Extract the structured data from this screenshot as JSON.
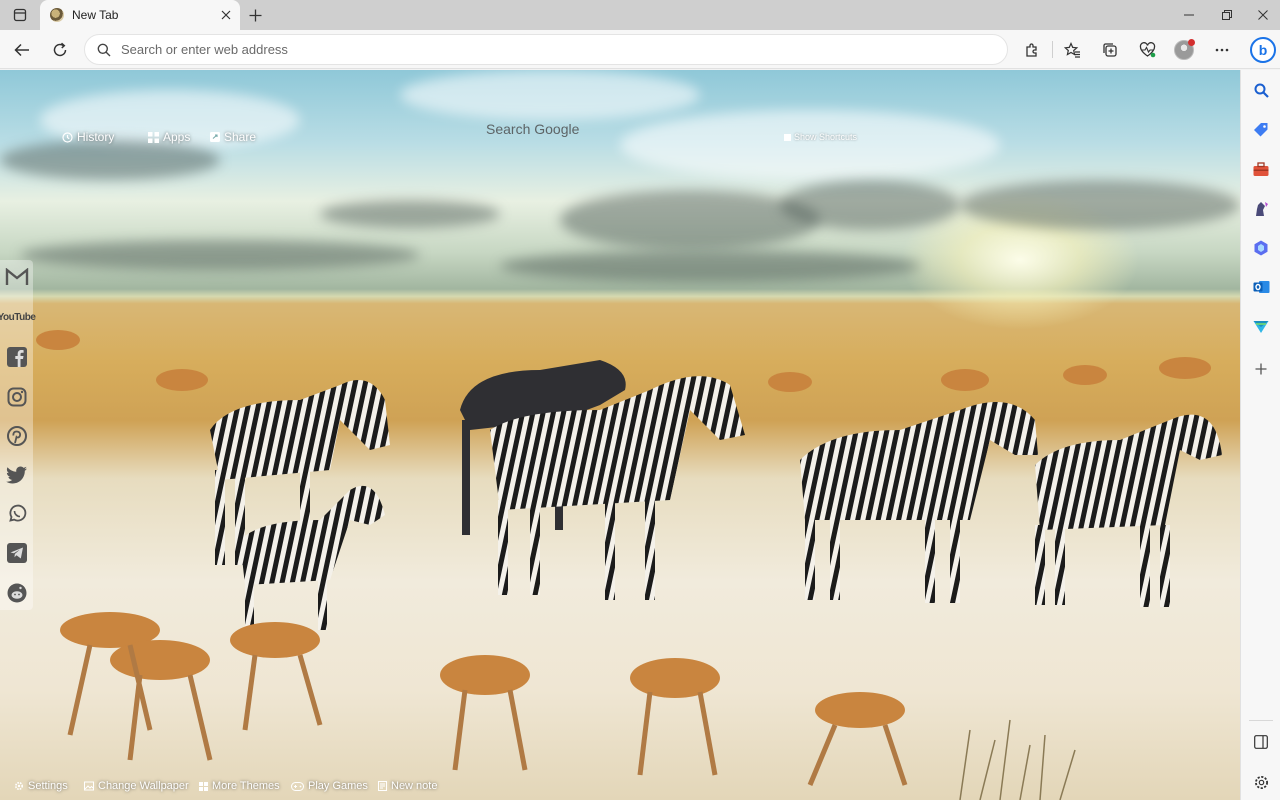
{
  "browser": {
    "tab": {
      "title": "New Tab"
    },
    "address_bar": {
      "placeholder": "Search or enter web address"
    }
  },
  "newtab": {
    "top_links": [
      {
        "label": "History",
        "icon": "history-icon"
      },
      {
        "label": "Apps",
        "icon": "grid-icon"
      },
      {
        "label": "Share",
        "icon": "share-icon"
      }
    ],
    "search_label": "Search Google",
    "show_shortcuts_label": "Show Shortcuts",
    "social_icons": [
      "gmail-icon",
      "youtube-icon",
      "facebook-icon",
      "instagram-icon",
      "pinterest-icon",
      "twitter-icon",
      "whatsapp-icon",
      "telegram-icon",
      "reddit-icon"
    ],
    "youtube_wordmark": "YouTube",
    "bottom_links": [
      {
        "label": "Settings",
        "icon": "gear-icon"
      },
      {
        "label": "Change Wallpaper",
        "icon": "image-icon"
      },
      {
        "label": "More Themes",
        "icon": "grid-icon"
      },
      {
        "label": "Play Games",
        "icon": "gamepad-icon"
      },
      {
        "label": "New note",
        "icon": "note-icon"
      }
    ]
  },
  "colors": {
    "accent": "#1a73e8",
    "notification_dot": "#d32f2f"
  }
}
